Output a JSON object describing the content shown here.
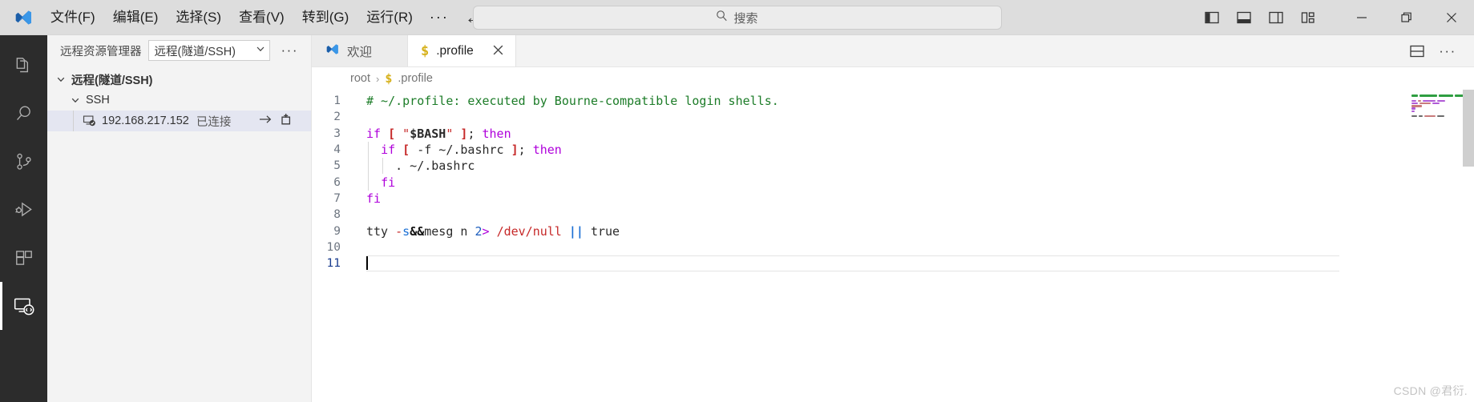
{
  "titlebar": {
    "logo_icon": "vscode-logo-icon",
    "menus": [
      "文件(F)",
      "编辑(E)",
      "选择(S)",
      "查看(V)",
      "转到(G)",
      "运行(R)"
    ],
    "menu_overflow": "···",
    "nav_back_icon": "arrow-left-icon",
    "nav_forward_icon": "arrow-right-icon",
    "command_center": {
      "placeholder": "搜索",
      "search_icon": "search-icon"
    },
    "layout_buttons": [
      {
        "name": "toggle-primary-sidebar",
        "icon": "layout-sidebar-left-icon"
      },
      {
        "name": "toggle-panel",
        "icon": "layout-panel-icon"
      },
      {
        "name": "toggle-secondary-sidebar",
        "icon": "layout-sidebar-right-icon"
      },
      {
        "name": "customize-layout",
        "icon": "layout-customize-icon"
      }
    ],
    "window_buttons": [
      {
        "name": "minimize-window-button",
        "icon": "minimize-icon"
      },
      {
        "name": "restore-window-button",
        "icon": "restore-icon"
      },
      {
        "name": "close-window-button",
        "icon": "close-icon"
      }
    ]
  },
  "activitybar": {
    "items": [
      {
        "name": "explorer",
        "icon": "files-icon",
        "active": false
      },
      {
        "name": "search",
        "icon": "search-icon",
        "active": false
      },
      {
        "name": "source-control",
        "icon": "source-control-icon",
        "active": false
      },
      {
        "name": "run-and-debug",
        "icon": "debug-icon",
        "active": false
      },
      {
        "name": "extensions",
        "icon": "extensions-icon",
        "active": false
      },
      {
        "name": "remote-explorer",
        "icon": "remote-explorer-icon",
        "active": true
      }
    ]
  },
  "sidebar": {
    "title": "远程资源管理器",
    "selector_value": "远程(隧道/SSH)",
    "selector_chevron_icon": "chevron-down-icon",
    "more_actions": "···",
    "tree": [
      {
        "label": "远程(隧道/SSH)",
        "level": 0,
        "chevron": "⌄",
        "expanded": true,
        "selected": false
      },
      {
        "label": "SSH",
        "level": 1,
        "chevron": "⌄",
        "expanded": true,
        "selected": false
      },
      {
        "label": "192.168.217.152",
        "description": "已连接",
        "level": 2,
        "selected": true,
        "icon": "remote-connected-icon",
        "action_connect_icon": "arrow-right-icon",
        "action_newwindow_icon": "new-window-icon"
      }
    ]
  },
  "editor": {
    "tabs": [
      {
        "label": "欢迎",
        "icon": "vscode-logo-icon",
        "active": false,
        "closable": false
      },
      {
        "label": ".profile",
        "icon": "shell-script-icon",
        "icon_glyph": "$",
        "active": true,
        "closable": true,
        "close_icon": "close-icon"
      }
    ],
    "tab_actions": [
      {
        "name": "split-editor-right-button",
        "icon": "split-editor-icon"
      },
      {
        "name": "editor-more-actions-button",
        "icon": "ellipsis-icon",
        "glyph": "···"
      }
    ],
    "breadcrumb": {
      "root": "root",
      "separator": "›",
      "file_icon_glyph": "$",
      "file": ".profile"
    },
    "language": "shellscript",
    "cursor_line": 11,
    "lines": [
      {
        "n": 1,
        "tokens": [
          {
            "t": "# ~/.profile: executed by Bourne-compatible login shells.",
            "c": "t-comment"
          }
        ]
      },
      {
        "n": 2,
        "tokens": []
      },
      {
        "n": 3,
        "tokens": [
          {
            "t": "if",
            "c": "t-kw"
          },
          {
            "t": " ",
            "c": "t-plain"
          },
          {
            "t": "[",
            "c": "t-brk"
          },
          {
            "t": " ",
            "c": "t-plain"
          },
          {
            "t": "\"",
            "c": "t-str"
          },
          {
            "t": "$BASH",
            "c": "t-var"
          },
          {
            "t": "\"",
            "c": "t-str"
          },
          {
            "t": " ",
            "c": "t-plain"
          },
          {
            "t": "]",
            "c": "t-brk"
          },
          {
            "t": ";",
            "c": "t-semi"
          },
          {
            "t": " ",
            "c": "t-plain"
          },
          {
            "t": "then",
            "c": "t-kw"
          }
        ]
      },
      {
        "n": 4,
        "tokens": [
          {
            "t": "  ",
            "c": "t-plain"
          },
          {
            "t": "if",
            "c": "t-kw"
          },
          {
            "t": " ",
            "c": "t-plain"
          },
          {
            "t": "[",
            "c": "t-brk"
          },
          {
            "t": " -f ~/.bashrc ",
            "c": "t-plain"
          },
          {
            "t": "]",
            "c": "t-brk"
          },
          {
            "t": ";",
            "c": "t-semi"
          },
          {
            "t": " ",
            "c": "t-plain"
          },
          {
            "t": "then",
            "c": "t-kw"
          }
        ]
      },
      {
        "n": 5,
        "tokens": [
          {
            "t": "    . ~/.bashrc",
            "c": "t-plain"
          }
        ]
      },
      {
        "n": 6,
        "tokens": [
          {
            "t": "  ",
            "c": "t-plain"
          },
          {
            "t": "fi",
            "c": "t-kw"
          }
        ]
      },
      {
        "n": 7,
        "tokens": [
          {
            "t": "fi",
            "c": "t-kw"
          }
        ]
      },
      {
        "n": 8,
        "tokens": []
      },
      {
        "n": 9,
        "tokens": [
          {
            "t": "tty",
            "c": "t-plain"
          },
          {
            "t": " ",
            "c": "t-plain"
          },
          {
            "t": "-",
            "c": "t-dash"
          },
          {
            "t": "s",
            "c": "t-opt"
          },
          {
            "t": "&&",
            "c": "t-amp"
          },
          {
            "t": "mesg n ",
            "c": "t-plain"
          },
          {
            "t": "2",
            "c": "t-num"
          },
          {
            "t": ">",
            "c": "t-redir"
          },
          {
            "t": " ",
            "c": "t-plain"
          },
          {
            "t": "/dev/null",
            "c": "t-path"
          },
          {
            "t": " ",
            "c": "t-plain"
          },
          {
            "t": "||",
            "c": "t-pipe"
          },
          {
            "t": " ",
            "c": "t-plain"
          },
          {
            "t": "true",
            "c": "t-plain"
          }
        ]
      },
      {
        "n": 10,
        "tokens": []
      },
      {
        "n": 11,
        "tokens": [],
        "current": true
      }
    ],
    "minimap": {
      "rows": [
        [
          {
            "w": 8,
            "color": "#2f9e41"
          },
          {
            "w": 22,
            "color": "#2f9e41"
          },
          {
            "w": 18,
            "color": "#2f9e41"
          },
          {
            "w": 12,
            "color": "#2f9e41"
          }
        ],
        [],
        [
          {
            "w": 6,
            "color": "#b05ad6"
          },
          {
            "w": 4,
            "color": "#c97b7b"
          },
          {
            "w": 16,
            "color": "#b05ad6"
          },
          {
            "w": 10,
            "color": "#b05ad6"
          }
        ],
        [
          {
            "w": 8,
            "color": "#b05ad6"
          },
          {
            "w": 14,
            "color": "#c97b7b"
          },
          {
            "w": 9,
            "color": "#b05ad6"
          }
        ],
        [
          {
            "w": 13,
            "color": "#c97b7b"
          }
        ],
        [
          {
            "w": 5,
            "color": "#b05ad6"
          }
        ],
        [
          {
            "w": 4,
            "color": "#b05ad6"
          }
        ],
        [],
        [
          {
            "w": 7,
            "color": "#6a6a6a"
          },
          {
            "w": 5,
            "color": "#6a6a6a"
          },
          {
            "w": 14,
            "color": "#c97b7b"
          },
          {
            "w": 9,
            "color": "#6a6a6a"
          }
        ]
      ]
    }
  },
  "watermark": "CSDN @君衍."
}
